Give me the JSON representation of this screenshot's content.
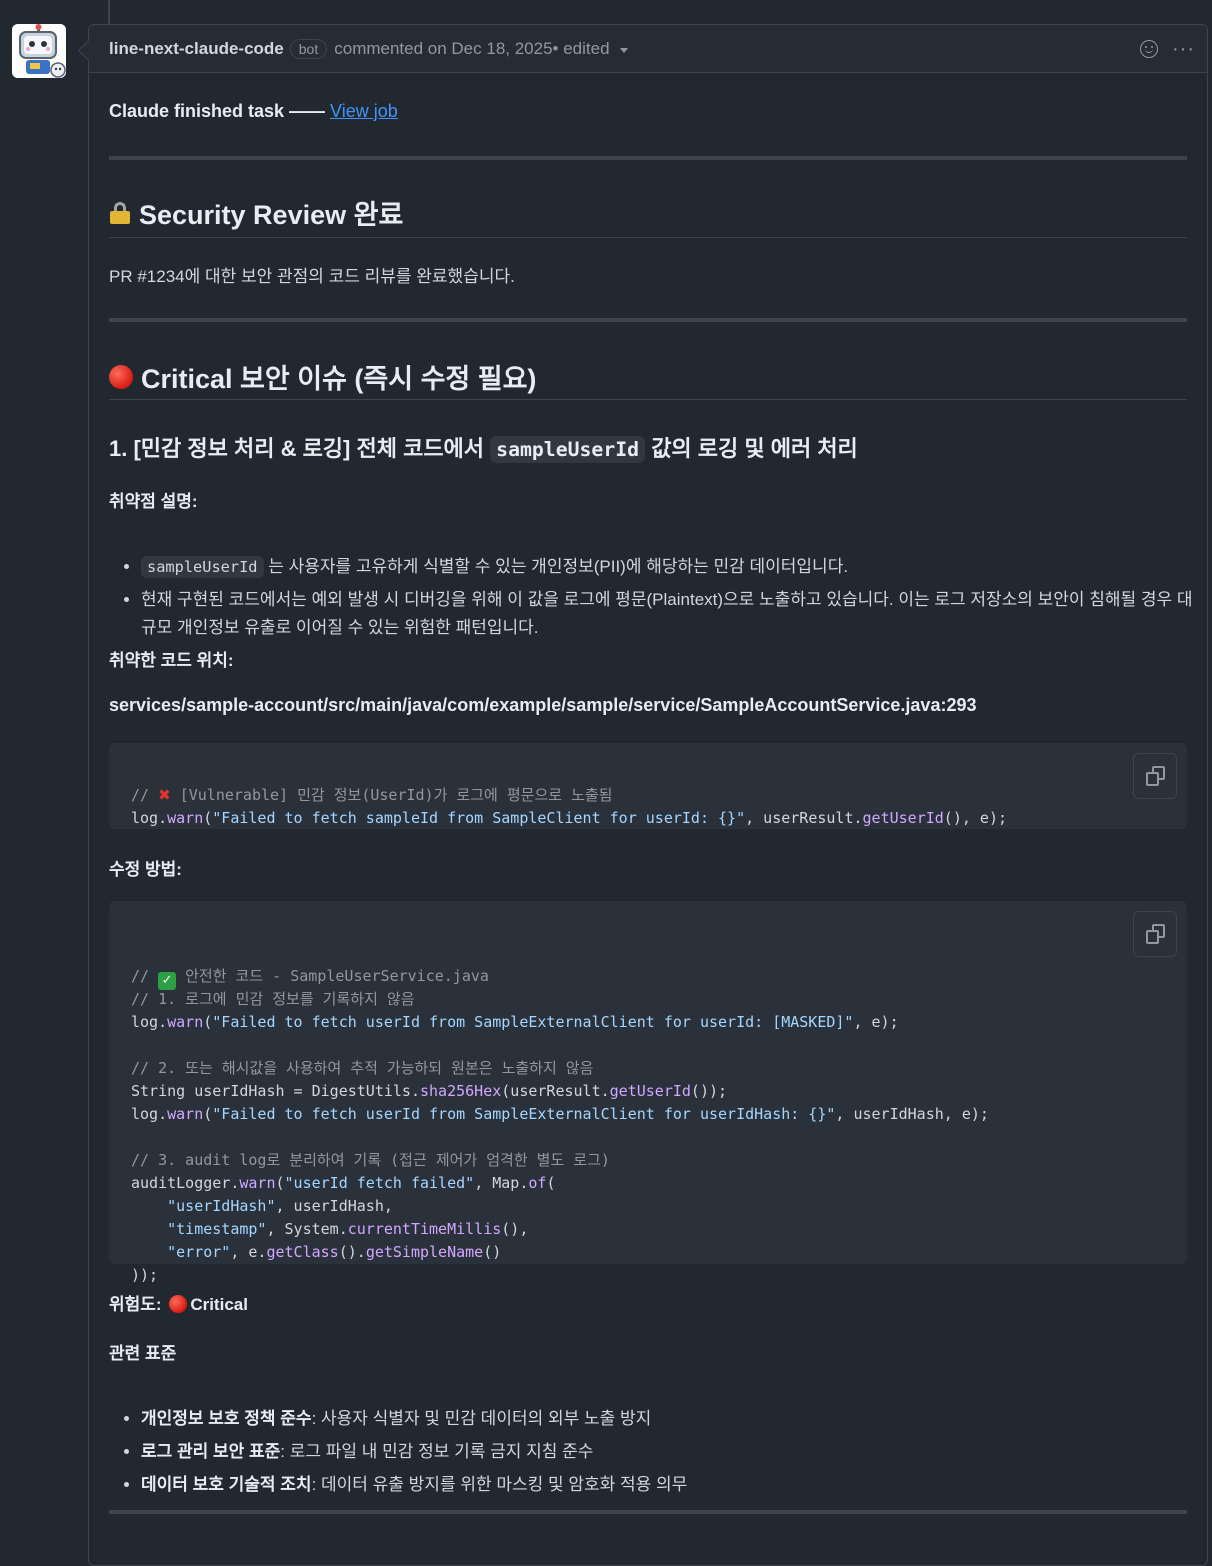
{
  "comment": {
    "author": "line-next-claude-code",
    "badge": "bot",
    "meta": "commented on Dec 18, 2025",
    "edited": "• edited",
    "more": "···"
  },
  "intro": {
    "text": "Claude finished task —— ",
    "link": "View job"
  },
  "sections": {
    "security_review_title": "Security Review 완료",
    "security_review_body": "PR #1234에 대한 보안 관점의 코드 리뷰를 완료했습니다.",
    "critical_title": "Critical 보안 이슈 (즉시 수정 필요)",
    "issue1_prefix": "1. [민감 정보 처리 & 로깅] 전체 코드에서 ",
    "issue1_code": "sampleUserId",
    "issue1_suffix": " 값의 로깅 및 에러 처리",
    "vuln_desc_label": "취약점 설명:",
    "vuln_items": [
      {
        "code": "sampleUserId",
        "text": " 는 사용자를 고유하게 식별할 수 있는 개인정보(PII)에 해당하는 민감 데이터입니다."
      },
      {
        "code": "",
        "text": "현재 구현된 코드에서는 예외 발생 시 디버깅을 위해 이 값을 로그에 평문(Plaintext)으로 노출하고 있습니다. 이는 로그 저장소의 보안이 침해될 경우 대규모 개인정보 유출로 이어질 수 있는 위험한 패턴입니다."
      }
    ],
    "location_label": "취약한 코드 위치:",
    "location_path": "services/sample-account/src/main/java/com/example/sample/service/SampleAccountService.java:293",
    "fix_label": "수정 방법:",
    "risk_label": "위험도: ",
    "risk_value": "Critical",
    "standards_label": "관련 표준",
    "standards": [
      {
        "title": "개인정보 보호 정책 준수",
        "text": ": 사용자 식별자 및 민감 데이터의 외부 노출 방지"
      },
      {
        "title": "로그 관리 보안 표준",
        "text": ": 로그 파일 내 민감 정보 기록 금지 지침 준수"
      },
      {
        "title": "데이터 보호 기술적 조치",
        "text": ": 데이터 유출 방지를 위한 마스킹 및 암호화 적용 의무"
      }
    ]
  },
  "code1": {
    "comment_prefix": "// ",
    "comment_text": " [Vulnerable] 민감 정보(UserId)가 로그에 평문으로 노출됨",
    "line2_a": "log.",
    "line2_fn": "warn",
    "line2_b": "(",
    "line2_str": "\"Failed to fetch sampleId from SampleClient for userId: {}\"",
    "line2_c": ", userResult.",
    "line2_fn2": "getUserId",
    "line2_d": "(), e);"
  },
  "code2_lines": [
    "// ✅ 안전한 코드 - SampleUserService.java",
    "// 1. 로그에 민감 정보를 기록하지 않음",
    "log.warn(\"Failed to fetch userId from SampleExternalClient for userId: [MASKED]\", e);",
    "",
    "// 2. 또는 해시값을 사용하여 추적 가능하되 원본은 노출하지 않음",
    "String userIdHash = DigestUtils.sha256Hex(userResult.getUserId());",
    "log.warn(\"Failed to fetch userId from SampleExternalClient for userIdHash: {}\", userIdHash, e);",
    "",
    "// 3. audit log로 분리하여 기록 (접근 제어가 엄격한 별도 로그)",
    "auditLogger.warn(\"userId fetch failed\", Map.of(",
    "    \"userIdHash\", userIdHash,",
    "    \"timestamp\", System.currentTimeMillis(),",
    "    \"error\", e.getClass().getSimpleName()",
    "));"
  ],
  "colors": {
    "background": "#212830",
    "link": "#4493f8",
    "code_string": "#a5d6ff",
    "code_function": "#d2a8ff",
    "code_comment": "#9198a1",
    "critical_red": "#d71c12"
  }
}
